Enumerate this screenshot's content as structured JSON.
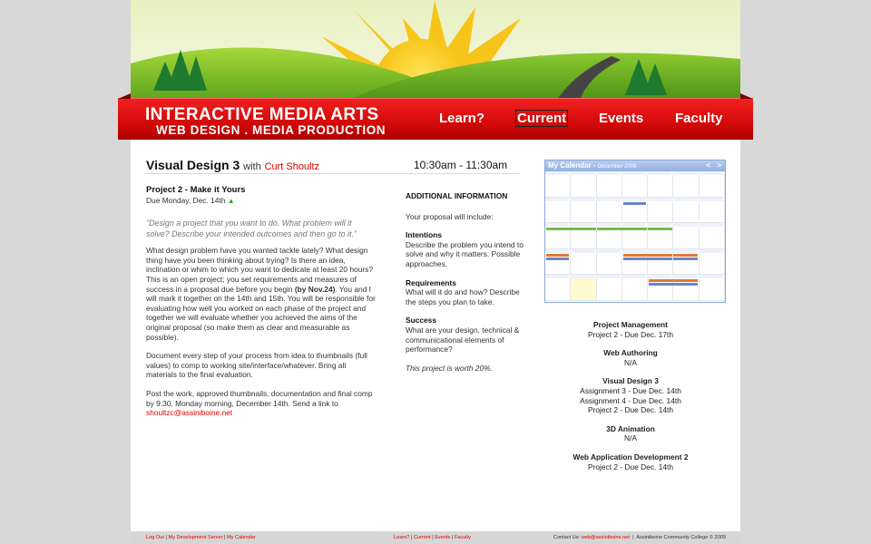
{
  "brand": {
    "title": "INTERACTIVE MEDIA ARTS",
    "subtitle": "WEB DESIGN . MEDIA PRODUCTION"
  },
  "nav": {
    "items": [
      {
        "label": "Learn?"
      },
      {
        "label": "Current"
      },
      {
        "label": "Events"
      },
      {
        "label": "Faculty"
      }
    ],
    "active": "Current"
  },
  "class_header": {
    "course": "Visual Design 3",
    "with": "with",
    "instructor": "Curt Shoultz",
    "time": "10:30am - 11:30am"
  },
  "project": {
    "title": "Project 2 - Make it Yours",
    "due": "Due Monday, Dec. 14th",
    "quote": "\"Design a project that you want to do. What problem will it solve? Describe your intended outcomes and then go to it.\"",
    "para1_a": "What design problem have you wanted tackle lately? What design thing have you been thinking about trying? Is there an idea, inclination or whim to which you want to dedicate at least 20 hours? This is an open project; you set requirements and measures of success in a proposal due before you begin ",
    "para1_bold": "(by Nov.24)",
    "para1_b": ". You and I will mark it together on the 14th and 15th. You will be responsible for evaluating how well you worked on each phase of the project and together we will evaluate whether you achieved the aims of the original proposal (so make them as clear and measurable as possible).",
    "para2": "Document every step of your process from idea to thumbnails (full values) to comp to working site/interface/whatever. Bring all materials to the final evaluation.",
    "para3": "Post the work, approved thumbnails, documentation and final comp by 9:30, Monday morning, December 14th. Send a link to",
    "email": "shoultzc@assiniboine.net"
  },
  "additional_info": {
    "title": "ADDITIONAL INFORMATION",
    "intro": "Your proposal will include:",
    "sections": [
      {
        "head": "Intentions",
        "text": "Describe the problem you intend to solve and why it matters. Possible approaches."
      },
      {
        "head": "Requirements",
        "text": "What will it do and how? Describe the steps you plan to take."
      },
      {
        "head": "Success",
        "text": "What are your design, technical & communicational elements of performance?"
      }
    ],
    "worth": "This project is worth 20%."
  },
  "calendar": {
    "title": "My Calendar",
    "month": "December 2009",
    "prev": "<",
    "next": ">"
  },
  "schedule": [
    {
      "title": "Project Management",
      "lines": [
        "Project 2 - Due Dec. 17th"
      ]
    },
    {
      "title": "Web Authoring",
      "lines": [
        "N/A"
      ]
    },
    {
      "title": "Visual Design 3",
      "lines": [
        "Assignment 3 - Due Dec. 14th",
        "Assignment 4 - Due Dec. 14th",
        "Project 2 - Due Dec. 14th"
      ]
    },
    {
      "title": "3D Animation",
      "lines": [
        "N/A"
      ]
    },
    {
      "title": "Web Application Development 2",
      "lines": [
        "Project 2 - Due Dec. 14th"
      ]
    }
  ],
  "footer": {
    "left": [
      "Log Out",
      "My Development Server",
      "My Calendar"
    ],
    "mid": [
      "Learn?",
      "Current",
      "Events",
      "Faculty"
    ],
    "contact_label": "Contact Us:",
    "contact_email": "web@assiniboine.net",
    "copyright": "Assiniboine Community College © 2009"
  },
  "colors": {
    "accent_red": "#e00000",
    "nav_red": "#d40a0a",
    "calendar_blue": "#93afe0"
  }
}
